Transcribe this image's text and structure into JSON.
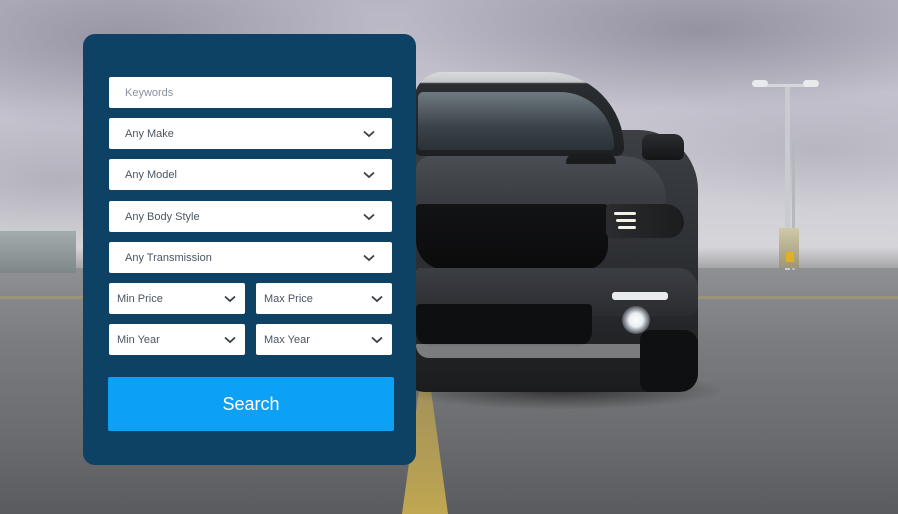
{
  "search_form": {
    "keywords_placeholder": "Keywords",
    "make": "Any Make",
    "model": "Any Model",
    "body_style": "Any Body Style",
    "transmission": "Any Transmission",
    "min_price": "Min Price",
    "max_price": "Max Price",
    "min_year": "Min Year",
    "max_year": "Max Year",
    "submit_label": "Search",
    "icons": {
      "dropdown": "chevron-down-icon"
    }
  },
  "colors": {
    "panel_background": "#0d4264",
    "button_background": "#0ca1f4",
    "field_background": "#ffffff"
  }
}
